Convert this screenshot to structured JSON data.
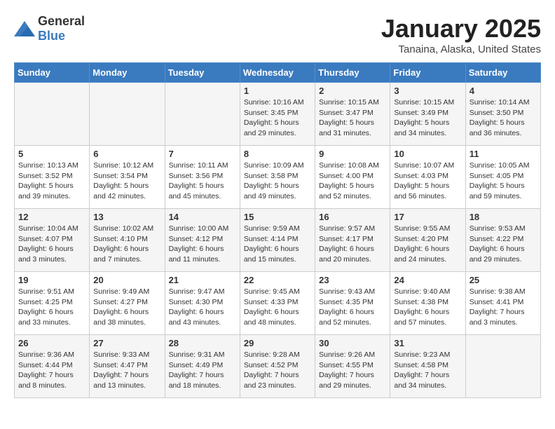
{
  "header": {
    "logo_general": "General",
    "logo_blue": "Blue",
    "month_title": "January 2025",
    "subtitle": "Tanaina, Alaska, United States"
  },
  "days_of_week": [
    "Sunday",
    "Monday",
    "Tuesday",
    "Wednesday",
    "Thursday",
    "Friday",
    "Saturday"
  ],
  "weeks": [
    [
      {
        "day": "",
        "info": ""
      },
      {
        "day": "",
        "info": ""
      },
      {
        "day": "",
        "info": ""
      },
      {
        "day": "1",
        "info": "Sunrise: 10:16 AM\nSunset: 3:45 PM\nDaylight: 5 hours and 29 minutes."
      },
      {
        "day": "2",
        "info": "Sunrise: 10:15 AM\nSunset: 3:47 PM\nDaylight: 5 hours and 31 minutes."
      },
      {
        "day": "3",
        "info": "Sunrise: 10:15 AM\nSunset: 3:49 PM\nDaylight: 5 hours and 34 minutes."
      },
      {
        "day": "4",
        "info": "Sunrise: 10:14 AM\nSunset: 3:50 PM\nDaylight: 5 hours and 36 minutes."
      }
    ],
    [
      {
        "day": "5",
        "info": "Sunrise: 10:13 AM\nSunset: 3:52 PM\nDaylight: 5 hours and 39 minutes."
      },
      {
        "day": "6",
        "info": "Sunrise: 10:12 AM\nSunset: 3:54 PM\nDaylight: 5 hours and 42 minutes."
      },
      {
        "day": "7",
        "info": "Sunrise: 10:11 AM\nSunset: 3:56 PM\nDaylight: 5 hours and 45 minutes."
      },
      {
        "day": "8",
        "info": "Sunrise: 10:09 AM\nSunset: 3:58 PM\nDaylight: 5 hours and 49 minutes."
      },
      {
        "day": "9",
        "info": "Sunrise: 10:08 AM\nSunset: 4:00 PM\nDaylight: 5 hours and 52 minutes."
      },
      {
        "day": "10",
        "info": "Sunrise: 10:07 AM\nSunset: 4:03 PM\nDaylight: 5 hours and 56 minutes."
      },
      {
        "day": "11",
        "info": "Sunrise: 10:05 AM\nSunset: 4:05 PM\nDaylight: 5 hours and 59 minutes."
      }
    ],
    [
      {
        "day": "12",
        "info": "Sunrise: 10:04 AM\nSunset: 4:07 PM\nDaylight: 6 hours and 3 minutes."
      },
      {
        "day": "13",
        "info": "Sunrise: 10:02 AM\nSunset: 4:10 PM\nDaylight: 6 hours and 7 minutes."
      },
      {
        "day": "14",
        "info": "Sunrise: 10:00 AM\nSunset: 4:12 PM\nDaylight: 6 hours and 11 minutes."
      },
      {
        "day": "15",
        "info": "Sunrise: 9:59 AM\nSunset: 4:14 PM\nDaylight: 6 hours and 15 minutes."
      },
      {
        "day": "16",
        "info": "Sunrise: 9:57 AM\nSunset: 4:17 PM\nDaylight: 6 hours and 20 minutes."
      },
      {
        "day": "17",
        "info": "Sunrise: 9:55 AM\nSunset: 4:20 PM\nDaylight: 6 hours and 24 minutes."
      },
      {
        "day": "18",
        "info": "Sunrise: 9:53 AM\nSunset: 4:22 PM\nDaylight: 6 hours and 29 minutes."
      }
    ],
    [
      {
        "day": "19",
        "info": "Sunrise: 9:51 AM\nSunset: 4:25 PM\nDaylight: 6 hours and 33 minutes."
      },
      {
        "day": "20",
        "info": "Sunrise: 9:49 AM\nSunset: 4:27 PM\nDaylight: 6 hours and 38 minutes."
      },
      {
        "day": "21",
        "info": "Sunrise: 9:47 AM\nSunset: 4:30 PM\nDaylight: 6 hours and 43 minutes."
      },
      {
        "day": "22",
        "info": "Sunrise: 9:45 AM\nSunset: 4:33 PM\nDaylight: 6 hours and 48 minutes."
      },
      {
        "day": "23",
        "info": "Sunrise: 9:43 AM\nSunset: 4:35 PM\nDaylight: 6 hours and 52 minutes."
      },
      {
        "day": "24",
        "info": "Sunrise: 9:40 AM\nSunset: 4:38 PM\nDaylight: 6 hours and 57 minutes."
      },
      {
        "day": "25",
        "info": "Sunrise: 9:38 AM\nSunset: 4:41 PM\nDaylight: 7 hours and 3 minutes."
      }
    ],
    [
      {
        "day": "26",
        "info": "Sunrise: 9:36 AM\nSunset: 4:44 PM\nDaylight: 7 hours and 8 minutes."
      },
      {
        "day": "27",
        "info": "Sunrise: 9:33 AM\nSunset: 4:47 PM\nDaylight: 7 hours and 13 minutes."
      },
      {
        "day": "28",
        "info": "Sunrise: 9:31 AM\nSunset: 4:49 PM\nDaylight: 7 hours and 18 minutes."
      },
      {
        "day": "29",
        "info": "Sunrise: 9:28 AM\nSunset: 4:52 PM\nDaylight: 7 hours and 23 minutes."
      },
      {
        "day": "30",
        "info": "Sunrise: 9:26 AM\nSunset: 4:55 PM\nDaylight: 7 hours and 29 minutes."
      },
      {
        "day": "31",
        "info": "Sunrise: 9:23 AM\nSunset: 4:58 PM\nDaylight: 7 hours and 34 minutes."
      },
      {
        "day": "",
        "info": ""
      }
    ]
  ]
}
